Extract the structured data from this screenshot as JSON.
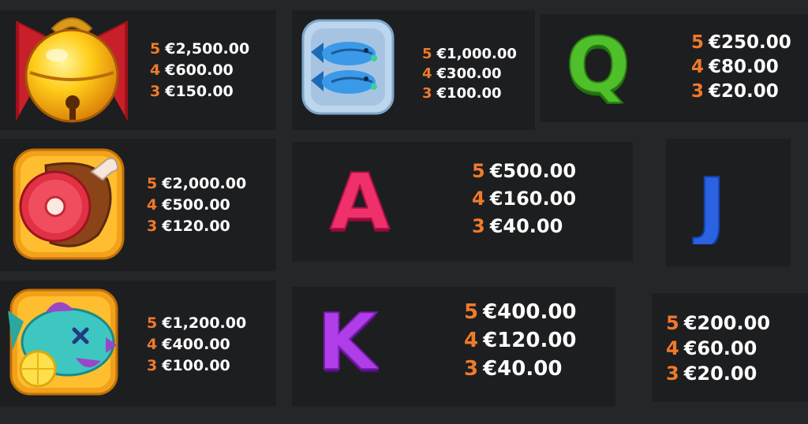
{
  "colors": {
    "background": "#252628",
    "panel": "#1d1e20",
    "count": "#f07a2a",
    "amount": "#ffffff"
  },
  "symbols": [
    {
      "icon": "bell-icon",
      "pays": [
        {
          "count": "5",
          "amount": "€2,500.00"
        },
        {
          "count": "4",
          "amount": "€600.00"
        },
        {
          "count": "3",
          "amount": "€150.00"
        }
      ]
    },
    {
      "icon": "fish-plate-icon",
      "pays": [
        {
          "count": "5",
          "amount": "€1,000.00"
        },
        {
          "count": "4",
          "amount": "€300.00"
        },
        {
          "count": "3",
          "amount": "€100.00"
        }
      ]
    },
    {
      "icon": "letter-q-icon",
      "letter": "Q",
      "pays": [
        {
          "count": "5",
          "amount": "€250.00"
        },
        {
          "count": "4",
          "amount": "€80.00"
        },
        {
          "count": "3",
          "amount": "€20.00"
        }
      ]
    },
    {
      "icon": "ham-icon",
      "pays": [
        {
          "count": "5",
          "amount": "€2,000.00"
        },
        {
          "count": "4",
          "amount": "€500.00"
        },
        {
          "count": "3",
          "amount": "€120.00"
        }
      ]
    },
    {
      "icon": "letter-a-icon",
      "letter": "A",
      "pays": [
        {
          "count": "5",
          "amount": "€500.00"
        },
        {
          "count": "4",
          "amount": "€160.00"
        },
        {
          "count": "3",
          "amount": "€40.00"
        }
      ]
    },
    {
      "icon": "letter-j-icon",
      "letter": "J"
    },
    {
      "icon": "puffer-fish-icon",
      "pays": [
        {
          "count": "5",
          "amount": "€1,200.00"
        },
        {
          "count": "4",
          "amount": "€400.00"
        },
        {
          "count": "3",
          "amount": "€100.00"
        }
      ]
    },
    {
      "icon": "letter-k-icon",
      "letter": "K",
      "pays": [
        {
          "count": "5",
          "amount": "€400.00"
        },
        {
          "count": "4",
          "amount": "€120.00"
        },
        {
          "count": "3",
          "amount": "€40.00"
        }
      ]
    },
    {
      "pays": [
        {
          "count": "5",
          "amount": "€200.00"
        },
        {
          "count": "4",
          "amount": "€60.00"
        },
        {
          "count": "3",
          "amount": "€20.00"
        }
      ]
    }
  ]
}
